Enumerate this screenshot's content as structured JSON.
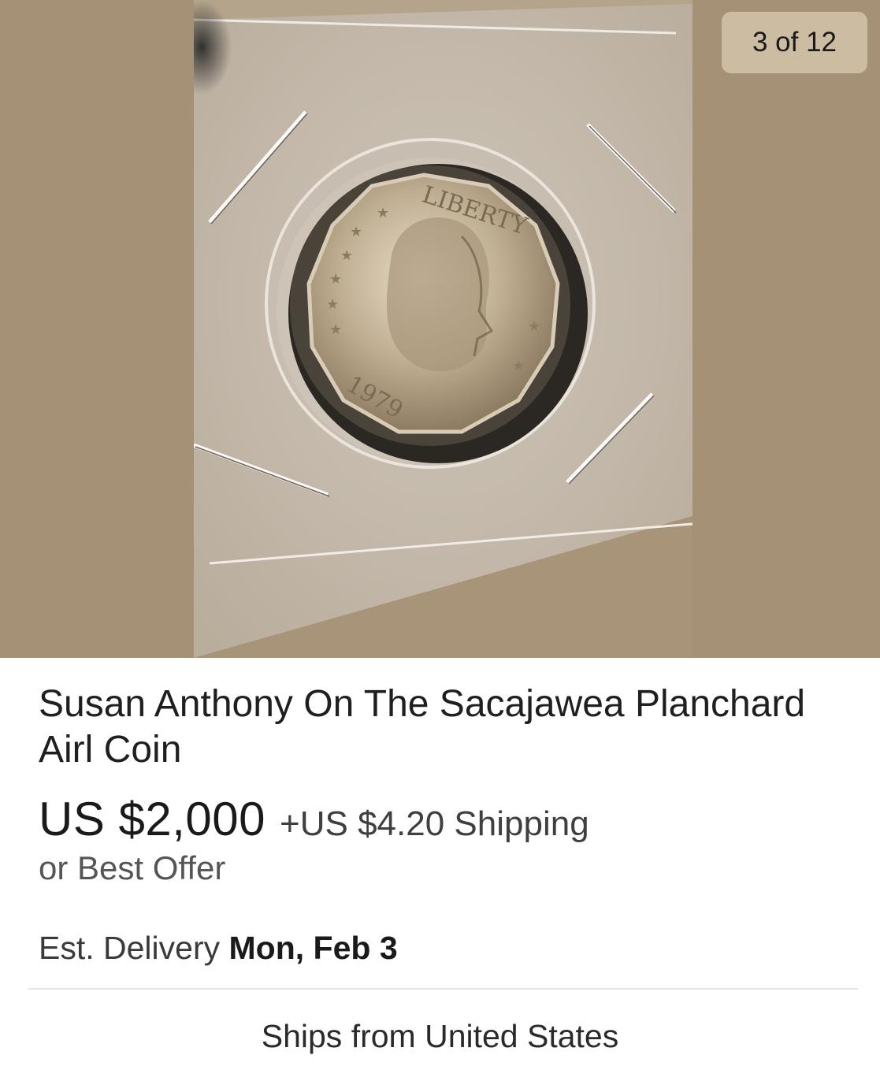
{
  "gallery": {
    "counter": "3 of 12",
    "background_color": "#a59276",
    "coin_inscription": "LIBERTY",
    "coin_year": "1979"
  },
  "listing": {
    "title": "Susan Anthony On The Sacajawea Planchard Airl Coin",
    "price": "US $2,000",
    "shipping": "+US $4.20 Shipping",
    "best_offer": "or Best Offer",
    "delivery_label": "Est. Delivery",
    "delivery_date": "Mon, Feb 3",
    "ships_from": "Ships from United States"
  }
}
